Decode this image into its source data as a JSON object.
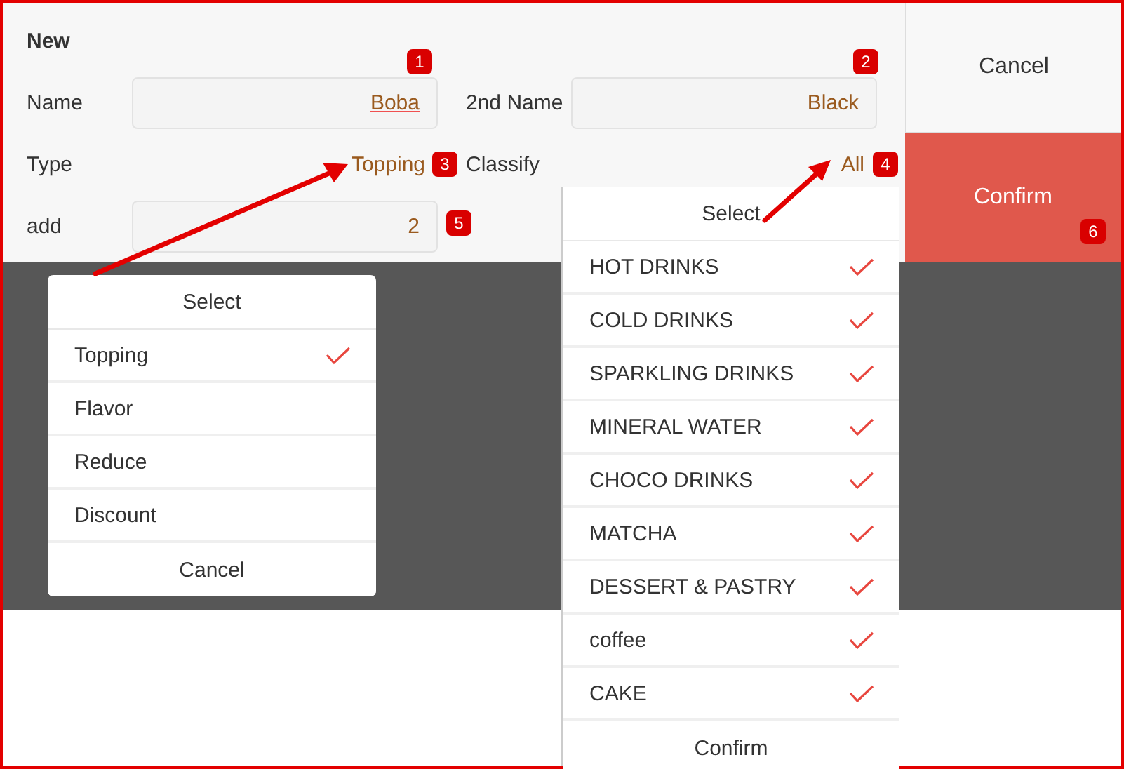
{
  "header": {
    "title": "New"
  },
  "name_field": {
    "label": "Name",
    "value": "Boba"
  },
  "second_name_field": {
    "label": "2nd Name",
    "value": "Black"
  },
  "type": {
    "label": "Type",
    "value": "Topping"
  },
  "classify": {
    "label": "Classify",
    "value": "All"
  },
  "add_field": {
    "label": "add",
    "value": "2"
  },
  "actions": [
    {
      "label": "Cancel",
      "kind": "plain"
    },
    {
      "label": "Confirm",
      "kind": "primary"
    }
  ],
  "type_picker": {
    "title": "Select",
    "footer": "Cancel",
    "options": [
      {
        "label": "Topping",
        "selected": true
      },
      {
        "label": "Flavor",
        "selected": false
      },
      {
        "label": "Reduce",
        "selected": false
      },
      {
        "label": "Discount",
        "selected": false
      }
    ]
  },
  "classify_picker": {
    "title": "Select",
    "footer": "Confirm",
    "options": [
      {
        "label": "HOT DRINKS",
        "checked": true
      },
      {
        "label": "COLD DRINKS",
        "checked": true
      },
      {
        "label": "SPARKLING DRINKS",
        "checked": true
      },
      {
        "label": "MINERAL WATER",
        "checked": true
      },
      {
        "label": "CHOCO DRINKS",
        "checked": true
      },
      {
        "label": "MATCHA",
        "checked": true
      },
      {
        "label": "DESSERT & PASTRY",
        "checked": true
      },
      {
        "label": "coffee",
        "checked": true
      },
      {
        "label": "CAKE",
        "checked": true
      }
    ]
  },
  "annotations": [
    {
      "label": "1"
    },
    {
      "label": "2"
    },
    {
      "label": "3"
    },
    {
      "label": "4"
    },
    {
      "label": "5"
    },
    {
      "label": "6"
    }
  ]
}
